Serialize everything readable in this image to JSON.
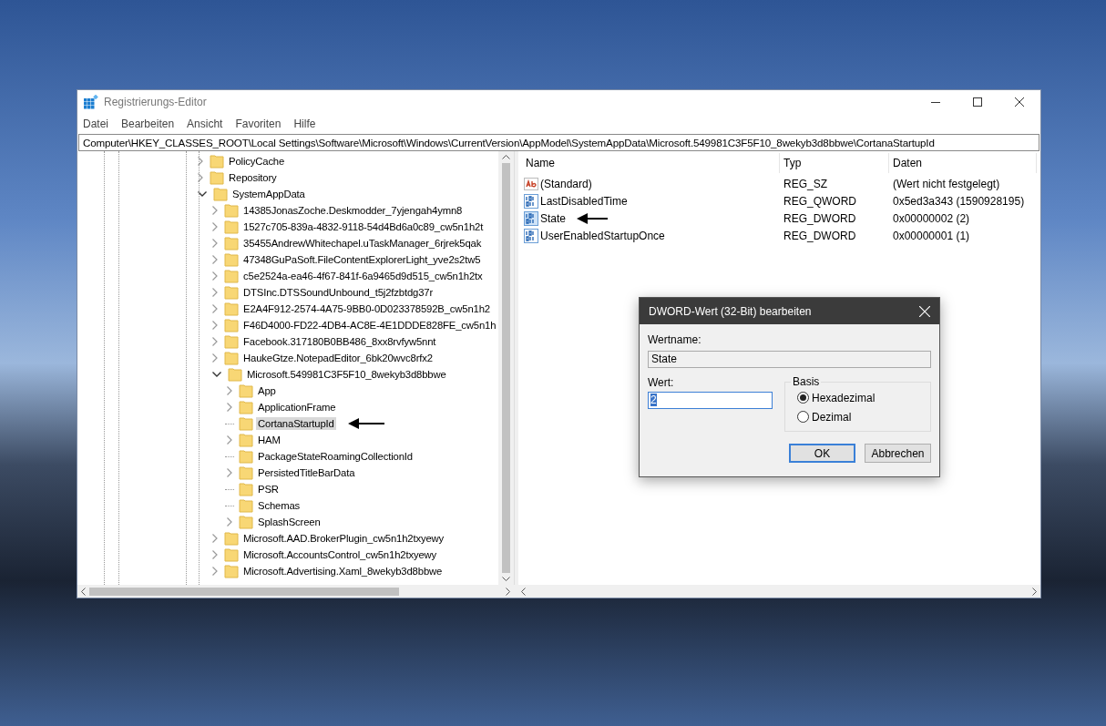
{
  "window": {
    "title": "Registrierungs-Editor"
  },
  "menu": [
    "Datei",
    "Bearbeiten",
    "Ansicht",
    "Favoriten",
    "Hilfe"
  ],
  "address": "Computer\\HKEY_CLASSES_ROOT\\Local Settings\\Software\\Microsoft\\Windows\\CurrentVersion\\AppModel\\SystemAppData\\Microsoft.549981C3F5F10_8wekyb3d8bbwe\\CortanaStartupId",
  "tree": [
    {
      "label": "PolicyCache",
      "expandable": true,
      "expanded": false,
      "selected": false
    },
    {
      "label": "Repository",
      "expandable": true,
      "expanded": false,
      "selected": false
    },
    {
      "label": "SystemAppData",
      "expandable": true,
      "expanded": true,
      "selected": false,
      "children": [
        {
          "label": "14385JonasZoche.Deskmodder_7yjengah4ymn8",
          "expandable": true,
          "expanded": false,
          "selected": false
        },
        {
          "label": "1527c705-839a-4832-9118-54d4Bd6a0c89_cw5n1h2t",
          "expandable": true,
          "expanded": false,
          "selected": false
        },
        {
          "label": "35455AndrewWhitechapel.uTaskManager_6rjrek5qak",
          "expandable": true,
          "expanded": false,
          "selected": false
        },
        {
          "label": "47348GuPaSoft.FileContentExplorerLight_yve2s2tw5",
          "expandable": true,
          "expanded": false,
          "selected": false
        },
        {
          "label": "c5e2524a-ea46-4f67-841f-6a9465d9d515_cw5n1h2tx",
          "expandable": true,
          "expanded": false,
          "selected": false
        },
        {
          "label": "DTSInc.DTSSoundUnbound_t5j2fzbtdg37r",
          "expandable": true,
          "expanded": false,
          "selected": false
        },
        {
          "label": "E2A4F912-2574-4A75-9BB0-0D023378592B_cw5n1h2",
          "expandable": true,
          "expanded": false,
          "selected": false
        },
        {
          "label": "F46D4000-FD22-4DB4-AC8E-4E1DDDE828FE_cw5n1h",
          "expandable": true,
          "expanded": false,
          "selected": false
        },
        {
          "label": "Facebook.317180B0BB486_8xx8rvfyw5nnt",
          "expandable": true,
          "expanded": false,
          "selected": false
        },
        {
          "label": "HaukeGtze.NotepadEditor_6bk20wvc8rfx2",
          "expandable": true,
          "expanded": false,
          "selected": false
        },
        {
          "label": "Microsoft.549981C3F5F10_8wekyb3d8bbwe",
          "expandable": true,
          "expanded": true,
          "selected": false,
          "children": [
            {
              "label": "App",
              "expandable": true,
              "expanded": false,
              "selected": false
            },
            {
              "label": "ApplicationFrame",
              "expandable": true,
              "expanded": false,
              "selected": false
            },
            {
              "label": "CortanaStartupId",
              "expandable": false,
              "selected": true,
              "marked": true
            },
            {
              "label": "HAM",
              "expandable": true,
              "expanded": false,
              "selected": false
            },
            {
              "label": "PackageStateRoamingCollectionId",
              "expandable": false,
              "selected": false
            },
            {
              "label": "PersistedTitleBarData",
              "expandable": true,
              "expanded": false,
              "selected": false
            },
            {
              "label": "PSR",
              "expandable": false,
              "selected": false
            },
            {
              "label": "Schemas",
              "expandable": false,
              "selected": false
            },
            {
              "label": "SplashScreen",
              "expandable": true,
              "expanded": false,
              "selected": false
            }
          ]
        },
        {
          "label": "Microsoft.AAD.BrokerPlugin_cw5n1h2txyewy",
          "expandable": true,
          "expanded": false,
          "selected": false
        },
        {
          "label": "Microsoft.AccountsControl_cw5n1h2txyewy",
          "expandable": true,
          "expanded": false,
          "selected": false
        },
        {
          "label": "Microsoft.Advertising.Xaml_8wekyb3d8bbwe",
          "expandable": true,
          "expanded": false,
          "selected": false
        }
      ]
    }
  ],
  "values": {
    "columns": [
      "Name",
      "Typ",
      "Daten"
    ],
    "rows": [
      {
        "kind": "string",
        "name": "(Standard)",
        "type": "REG_SZ",
        "data": "(Wert nicht festgelegt)"
      },
      {
        "kind": "binary",
        "name": "LastDisabledTime",
        "type": "REG_QWORD",
        "data": "0x5ed3a343 (1590928195)"
      },
      {
        "kind": "binary",
        "name": "State",
        "type": "REG_DWORD",
        "data": "0x00000002 (2)",
        "marked": true
      },
      {
        "kind": "binary",
        "name": "UserEnabledStartupOnce",
        "type": "REG_DWORD",
        "data": "0x00000001 (1)"
      }
    ]
  },
  "dialog": {
    "title": "DWORD-Wert (32-Bit) bearbeiten",
    "name_label": "Wertname:",
    "name_value": "State",
    "value_label": "Wert:",
    "value": "2",
    "base_label": "Basis",
    "bases": [
      {
        "label": "Hexadezimal",
        "selected": true
      },
      {
        "label": "Dezimal",
        "selected": false
      }
    ],
    "buttons": [
      {
        "label": "OK",
        "default": true
      },
      {
        "label": "Abbrechen",
        "default": false
      }
    ]
  }
}
